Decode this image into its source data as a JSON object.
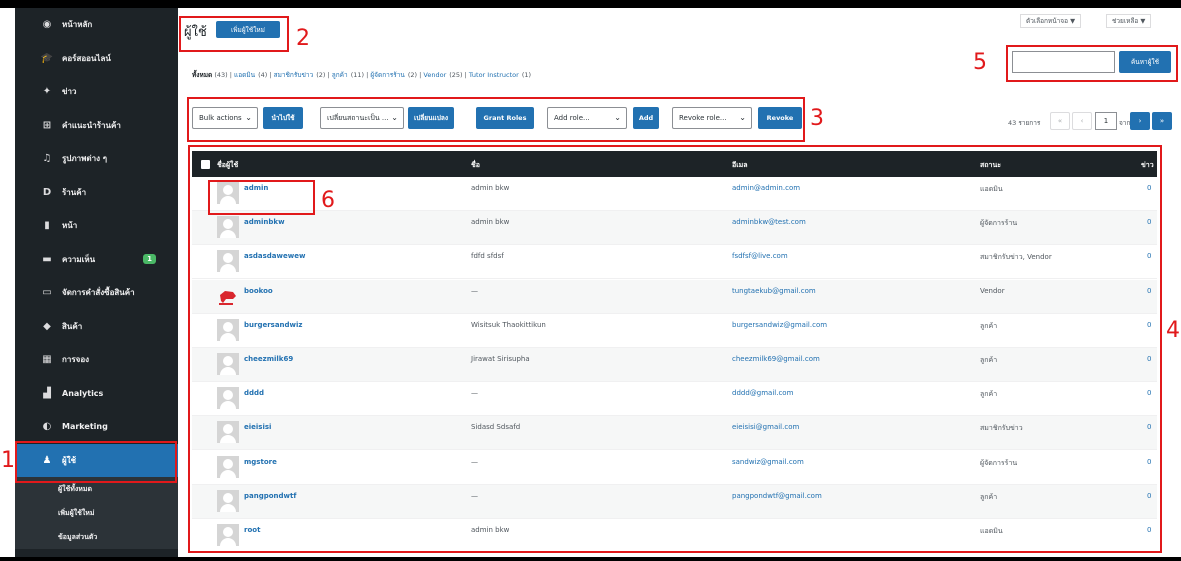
{
  "sidebar": {
    "items": [
      {
        "label": "หน้าหลัก",
        "icon": "palette-icon",
        "glyph": "◉"
      },
      {
        "label": "คอร์สออนไลน์",
        "icon": "graduation-cap-icon",
        "glyph": "🎓"
      },
      {
        "label": "ข่าว",
        "icon": "pin-icon",
        "glyph": "✦"
      },
      {
        "label": "คำแนะนำร้านค้า",
        "icon": "grid-icon",
        "glyph": "⊞"
      },
      {
        "label": "รูปภาพต่าง ๆ",
        "icon": "media-icon",
        "glyph": "♫"
      },
      {
        "label": "ร้านค้า",
        "icon": "d-logo-icon",
        "glyph": "D"
      },
      {
        "label": "หน้า",
        "icon": "page-icon",
        "glyph": "▮"
      },
      {
        "label": "ความเห็น",
        "icon": "comment-icon",
        "glyph": "▬",
        "badge": "1"
      },
      {
        "label": "จัดการคำสั่งซื้อสินค้า",
        "icon": "woo-icon",
        "glyph": "▭"
      },
      {
        "label": "สินค้า",
        "icon": "archive-icon",
        "glyph": "◆"
      },
      {
        "label": "การจอง",
        "icon": "calendar-icon",
        "glyph": "▦"
      },
      {
        "label": "Analytics",
        "icon": "bar-chart-icon",
        "glyph": "▟"
      },
      {
        "label": "Marketing",
        "icon": "megaphone-icon",
        "glyph": "◐"
      },
      {
        "label": "ผู้ใช้",
        "icon": "user-icon",
        "glyph": "♟",
        "active": true
      }
    ],
    "submenu": [
      "ผู้ใช้ทั้งหมด",
      "เพิ่มผู้ใช้ใหม่",
      "ข้อมูลส่วนตัว"
    ]
  },
  "header": {
    "title": "ผู้ใช้",
    "add_new": "เพิ่มผู้ใช้ใหม่",
    "screen_options": "ตัวเลือกหน้าจอ ▼",
    "help": "ช่วยเหลือ ▼"
  },
  "filters": {
    "all": "ทั้งหมด",
    "all_count": "(43)",
    "rest": [
      {
        "label": "แอดมิน",
        "count": "(4)"
      },
      {
        "label": "สมาชิกรับข่าว",
        "count": "(2)"
      },
      {
        "label": "ลูกค้า",
        "count": "(11)"
      },
      {
        "label": "ผู้จัดการร้าน",
        "count": "(2)"
      },
      {
        "label": "Vendor",
        "count": "(25)"
      },
      {
        "label": "Tutor Instructor",
        "count": "(1)"
      }
    ]
  },
  "search": {
    "button": "ค้นหาผู้ใช้",
    "value": ""
  },
  "toolbar": {
    "bulk_actions": "Bulk actions",
    "apply": "นำไปใช้",
    "change_role": "เปลี่ยนสถานะเป็น ...",
    "change_btn": "เปลี่ยนแปลง",
    "grant_roles": "Grant Roles",
    "add_role": "Add role...",
    "add": "Add",
    "revoke_role": "Revoke role...",
    "revoke": "Revoke"
  },
  "pagination": {
    "items": "43 รายการ",
    "first": "«",
    "prev": "‹",
    "current": "1",
    "of": "จาก 3",
    "next": "›",
    "last": "»"
  },
  "table": {
    "headers": {
      "username": "ชื่อผู้ใช้",
      "name": "ชื่อ",
      "email": "อีเมล",
      "role": "สถานะ",
      "posts": "ข่าว"
    },
    "rows": [
      {
        "username": "admin",
        "name": "admin bkw",
        "email": "admin@admin.com",
        "role": "แอดมิน",
        "posts": "0"
      },
      {
        "username": "adminbkw",
        "name": "admin bkw",
        "email": "adminbkw@test.com",
        "role": "ผู้จัดการร้าน",
        "posts": "0"
      },
      {
        "username": "asdasdawewew",
        "name": "fdfd sfdsf",
        "email": "fsdfsf@live.com",
        "role": "สมาชิกรับข่าว, Vendor",
        "posts": "0"
      },
      {
        "username": "bookoo",
        "name": "—",
        "email": "tungtaekub@gmail.com",
        "role": "Vendor",
        "posts": "0",
        "logo": true
      },
      {
        "username": "burgersandwiz",
        "name": "Wisitsuk Thaokittikun",
        "email": "burgersandwiz@gmail.com",
        "role": "ลูกค้า",
        "posts": "0"
      },
      {
        "username": "cheezmilk69",
        "name": "Jirawat Sirisupha",
        "email": "cheezmilk69@gmail.com",
        "role": "ลูกค้า",
        "posts": "0"
      },
      {
        "username": "dddd",
        "name": "—",
        "email": "dddd@gmail.com",
        "role": "ลูกค้า",
        "posts": "0"
      },
      {
        "username": "eieisisi",
        "name": "Sidasd Sdsafd",
        "email": "eieisisi@gmail.com",
        "role": "สมาชิกรับข่าว",
        "posts": "0"
      },
      {
        "username": "mgstore",
        "name": "—",
        "email": "sandwiz@gmail.com",
        "role": "ผู้จัดการร้าน",
        "posts": "0"
      },
      {
        "username": "pangpondwtf",
        "name": "—",
        "email": "pangpondwtf@gmail.com",
        "role": "ลูกค้า",
        "posts": "0"
      },
      {
        "username": "root",
        "name": "admin bkw",
        "email": "",
        "role": "แอดมิน",
        "posts": "0"
      }
    ]
  },
  "annotations": [
    "1",
    "2",
    "3",
    "4",
    "5",
    "6"
  ]
}
